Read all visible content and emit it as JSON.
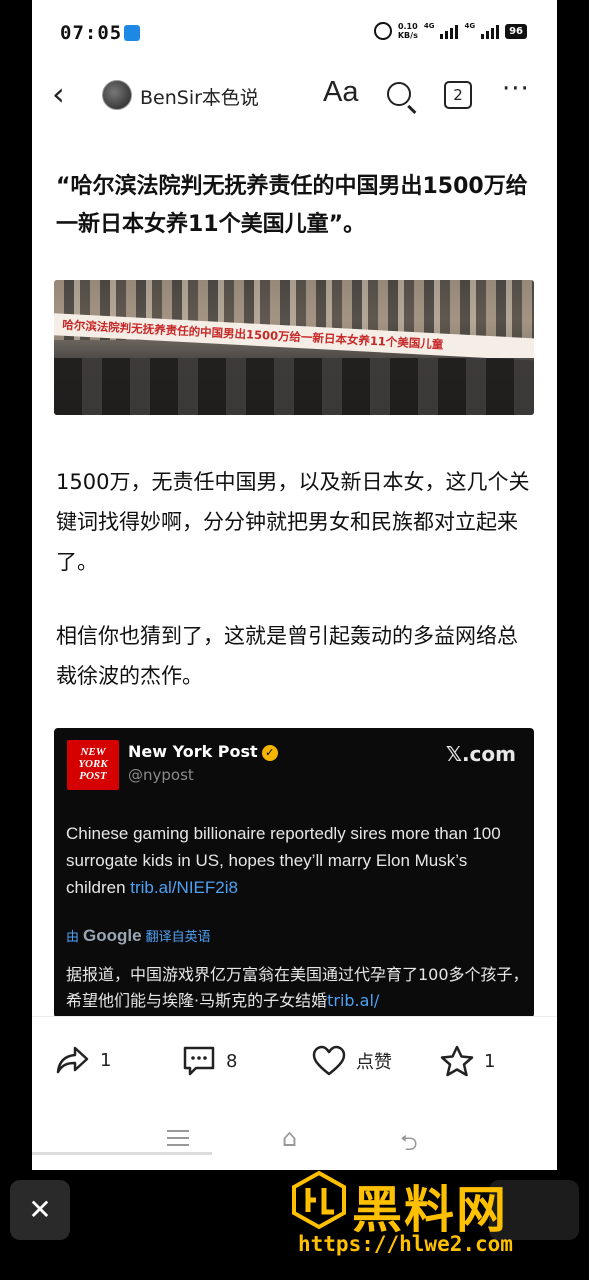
{
  "status_bar": {
    "time": "07:05",
    "net_speed_value": "0.10",
    "net_speed_unit": "KB/s",
    "sig1_tag": "4G",
    "sig2_tag": "4G",
    "battery": "96"
  },
  "header": {
    "back_glyph": "‹",
    "author": "BenSir本色说",
    "font_size_label": "Aa",
    "tab_count": "2",
    "more_glyph": "···"
  },
  "article": {
    "title": "“哈尔滨法院判无抚养责任的中国男出1500万给一新日本女养11个美国儿童”。",
    "image_banner": "哈尔滨法院判无抚养责任的中国男出1500万给一新日本女养11个美国儿童",
    "paragraph_1": "1500万，无责任中国男，以及新日本女，这几个关键词找得妙啊，分分钟就把男女和民族都对立起来了。",
    "paragraph_2": "相信你也猜到了，这就是曾引起轰动的多益网络总裁徐波的杰作。"
  },
  "tweet": {
    "logo_text": "NEW YORK POST",
    "account_name": "New York Post",
    "verified_glyph": "✓",
    "handle": "@nypost",
    "source": "𝕏.com",
    "body_text": "Chinese gaming billionaire reportedly sires more than 100 surrogate kids in US, hopes they’ll marry Elon Musk’s children ",
    "body_link": "trib.al/NIEF2i8",
    "translate_prefix": "由",
    "translate_brand": "Google",
    "translate_suffix": "翻译自英语",
    "translation": "据报道，中国游戏界亿万富翁在美国通过代孕育了100多个孩子，希望他们能与埃隆·马斯克的子女结婚",
    "translation_link": "trib.al/"
  },
  "actions": {
    "share_count": "1",
    "comment_count": "8",
    "like_label": "点赞",
    "favorite_count": "1"
  },
  "nav": {
    "home_glyph": "⌂",
    "back_glyph": "⮌"
  },
  "overlay": {
    "close_glyph": "✕",
    "watermark_text": "黑料网",
    "watermark_url": "https://hlwe2.com"
  },
  "colors": {
    "accent_gold": "#ffc000",
    "link_blue": "#4ea1f3",
    "nyp_red": "#d50000"
  }
}
